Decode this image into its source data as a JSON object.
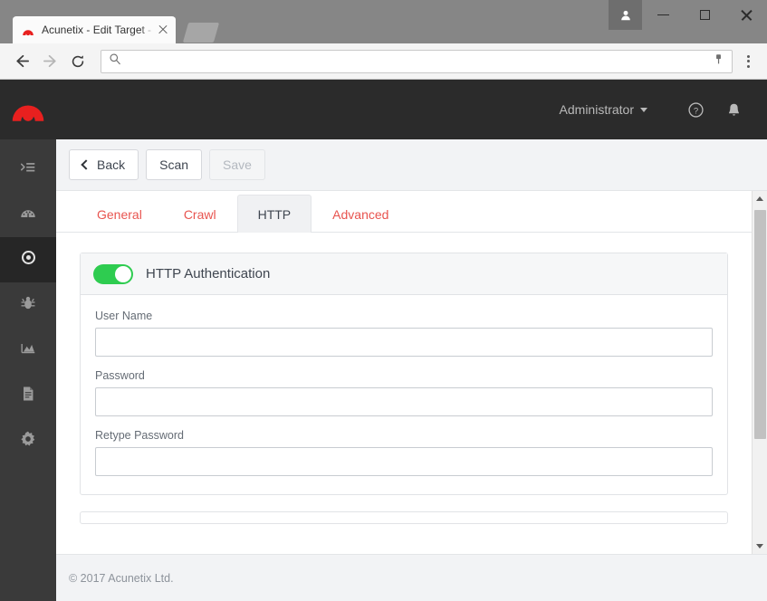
{
  "browser": {
    "tab": {
      "title": "Acunetix - Edit Target - h",
      "favicon_icon": "acunetix-logo-icon",
      "close_icon": "close-icon"
    },
    "new_tab_icon": "new-tab-icon",
    "window_controls": {
      "user_icon": "user-profile-icon",
      "minimize_icon": "minimize-icon",
      "maximize_icon": "maximize-icon",
      "close_icon": "close-icon"
    },
    "nav": {
      "back_icon": "arrow-left-icon",
      "forward_icon": "arrow-right-icon",
      "reload_icon": "reload-icon"
    },
    "omnibox": {
      "search_icon": "search-icon",
      "value": "",
      "placeholder": "",
      "bookmark_icon": "bookmark-key-icon"
    },
    "menu_icon": "kebab-menu-icon"
  },
  "app": {
    "logo_icon": "acunetix-logo-icon",
    "header": {
      "user_label": "Administrator",
      "caret_icon": "chevron-down-icon",
      "help_icon": "help-circle-icon",
      "notifications_icon": "bell-icon"
    },
    "sidebar": {
      "items": [
        {
          "name": "sidebar-item-menu",
          "icon": "list-menu-icon",
          "active": false
        },
        {
          "name": "sidebar-item-dashboard",
          "icon": "dashboard-gauge-icon",
          "active": false
        },
        {
          "name": "sidebar-item-targets",
          "icon": "target-crosshair-icon",
          "active": true
        },
        {
          "name": "sidebar-item-vulnerabilities",
          "icon": "bug-icon",
          "active": false
        },
        {
          "name": "sidebar-item-reports-chart",
          "icon": "area-chart-icon",
          "active": false
        },
        {
          "name": "sidebar-item-reports",
          "icon": "document-icon",
          "active": false
        },
        {
          "name": "sidebar-item-settings",
          "icon": "gear-icon",
          "active": false
        }
      ]
    },
    "action_bar": {
      "back_label": "Back",
      "back_icon": "chevron-left-icon",
      "scan_label": "Scan",
      "save_label": "Save",
      "save_disabled": true
    },
    "tabs": [
      {
        "label": "General",
        "active": false
      },
      {
        "label": "Crawl",
        "active": false
      },
      {
        "label": "HTTP",
        "active": true
      },
      {
        "label": "Advanced",
        "active": false
      }
    ],
    "http_card": {
      "toggle_name": "http-authentication-toggle",
      "toggle_on": true,
      "title": "HTTP Authentication",
      "fields": [
        {
          "label": "User Name",
          "value": "",
          "placeholder": "",
          "type": "text",
          "name": "user-name-field"
        },
        {
          "label": "Password",
          "value": "",
          "placeholder": "",
          "type": "password",
          "name": "password-field"
        },
        {
          "label": "Retype Password",
          "value": "",
          "placeholder": "",
          "type": "password",
          "name": "retype-password-field"
        }
      ]
    },
    "scrollbar": {
      "up_icon": "scroll-up-arrow-icon",
      "down_icon": "scroll-down-arrow-icon"
    },
    "footer": {
      "copyright": "© 2017 Acunetix Ltd."
    }
  },
  "colors": {
    "brand_red": "#e8201f",
    "link_red": "#e8544f",
    "toggle_green": "#2ecc50",
    "header_dark": "#2b2b2b",
    "sidebar_dark": "#3a3a3a"
  }
}
